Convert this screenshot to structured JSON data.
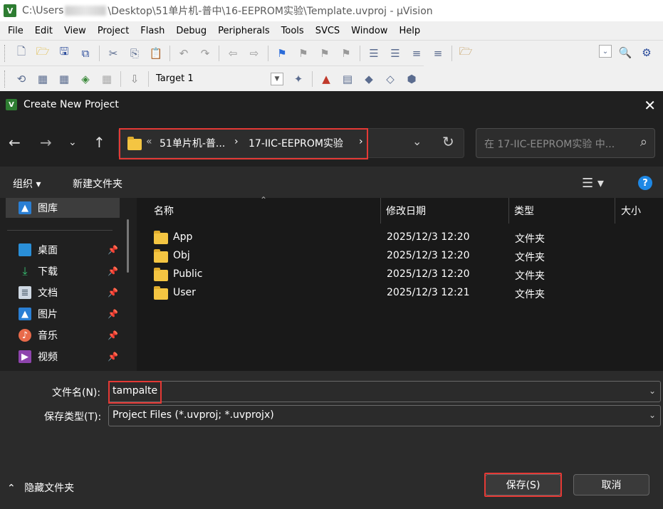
{
  "uvision": {
    "title_prefix": "C:\\Users",
    "title_suffix": "\\Desktop\\51单片机-普中\\16-EEPROM实验\\Template.uvproj - µVision",
    "logo": "V",
    "menu": [
      "File",
      "Edit",
      "View",
      "Project",
      "Flash",
      "Debug",
      "Peripherals",
      "Tools",
      "SVCS",
      "Window",
      "Help"
    ],
    "target": "Target 1"
  },
  "dialog": {
    "title": "Create New Project",
    "logo": "V",
    "breadcrumb": {
      "overflow": "«",
      "parent": "51单片机-普...",
      "current": "17-IIC-EEPROM实验",
      "sep": "›"
    },
    "search_placeholder": "在 17-IIC-EEPROM实验 中...",
    "commands": {
      "organize": "组织 ▾",
      "new_folder": "新建文件夹"
    },
    "nav_pane": {
      "gallery": "图库",
      "items": [
        "桌面",
        "下载",
        "文档",
        "图片",
        "音乐",
        "视频"
      ]
    },
    "columns": {
      "name": "名称",
      "modified": "修改日期",
      "type": "类型",
      "size": "大小"
    },
    "files": [
      {
        "name": "App",
        "modified": "2025/12/3 12:20",
        "type": "文件夹"
      },
      {
        "name": "Obj",
        "modified": "2025/12/3 12:20",
        "type": "文件夹"
      },
      {
        "name": "Public",
        "modified": "2025/12/3 12:20",
        "type": "文件夹"
      },
      {
        "name": "User",
        "modified": "2025/12/3 12:21",
        "type": "文件夹"
      }
    ],
    "filename_label": "文件名(N):",
    "filename_value": "tampalte",
    "filetype_label": "保存类型(T):",
    "filetype_value": "Project Files (*.uvproj; *.uvprojx)",
    "hide_folders": "隐藏文件夹",
    "save_label": "保存(S)",
    "cancel_label": "取消"
  },
  "colors": {
    "dialog_bg": "#2b2b2b",
    "highlight": "#e53935",
    "folder": "#f4c542",
    "help": "#1e88e5"
  }
}
